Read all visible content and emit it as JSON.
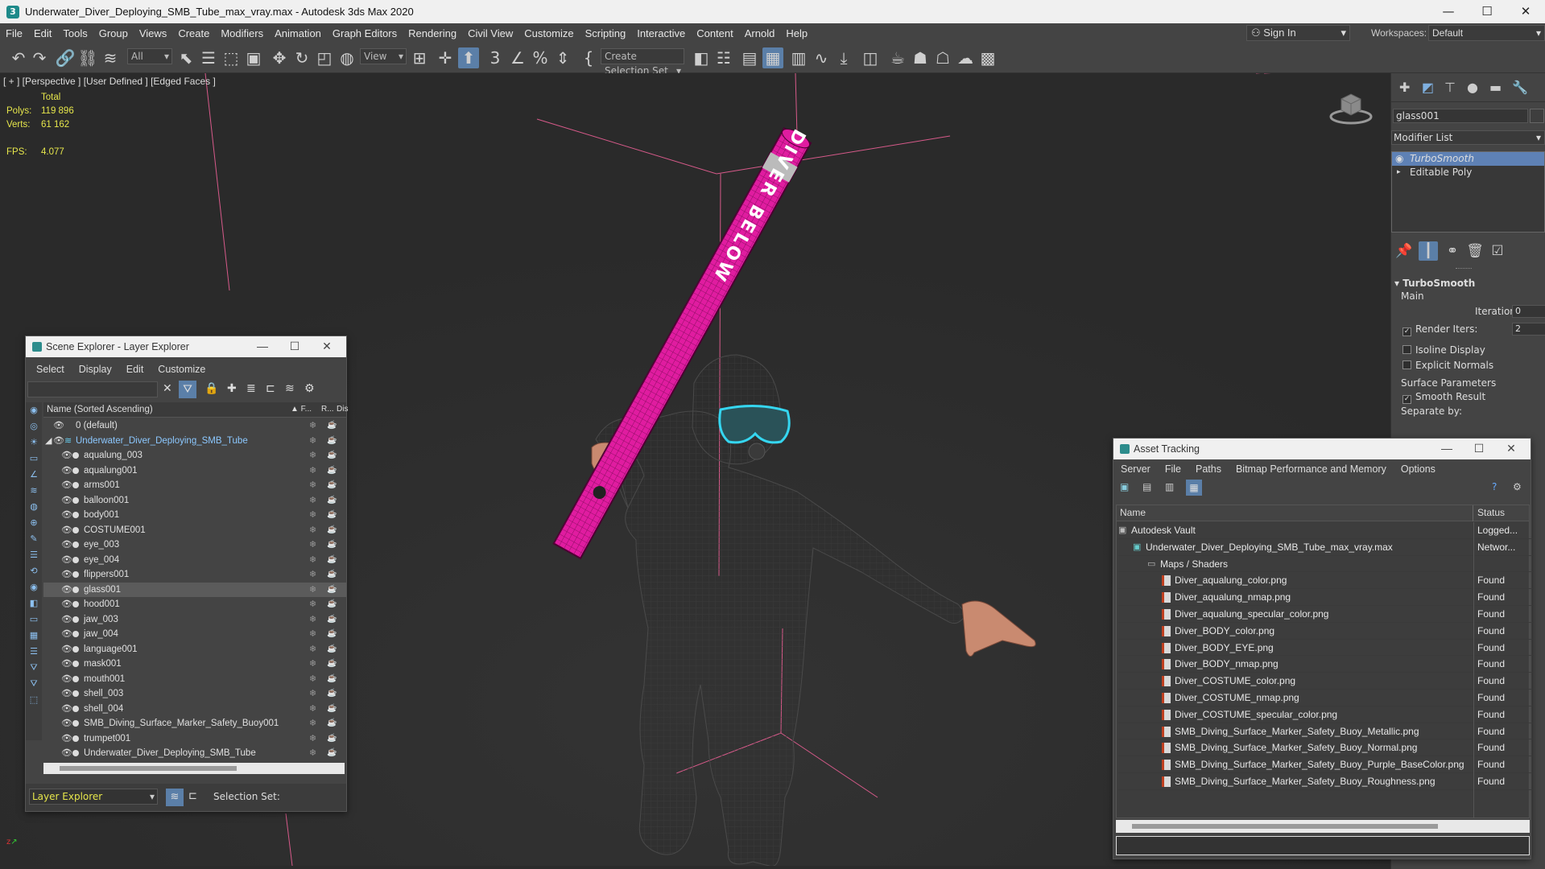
{
  "title_bar": {
    "text": "Underwater_Diver_Deploying_SMB_Tube_max_vray.max - Autodesk 3ds Max 2020",
    "min": "—",
    "max": "☐",
    "close": "✕"
  },
  "menu": [
    "File",
    "Edit",
    "Tools",
    "Group",
    "Views",
    "Create",
    "Modifiers",
    "Animation",
    "Graph Editors",
    "Rendering",
    "Civil View",
    "Customize",
    "Scripting",
    "Interactive",
    "Content",
    "Arnold",
    "Help"
  ],
  "signin": "Sign In",
  "workspaces": {
    "label": "Workspaces:",
    "value": "Default"
  },
  "toolbar": {
    "filter_value": "All",
    "refcoord_value": "View",
    "selection_set": "Create Selection Set"
  },
  "viewport": {
    "label": "[ + ] [Perspective ] [User Defined ] [Edged Faces ]",
    "stats": {
      "total_label": "Total",
      "polys_label": "Polys:",
      "polys": "119 896",
      "verts_label": "Verts:",
      "verts": "61 162",
      "fps_label": "FPS:",
      "fps": "4.077"
    },
    "tube_text": "DIVER BELOW"
  },
  "command_panel": {
    "object_name": "glass001",
    "modifier_list": "Modifier List",
    "stack": [
      "TurboSmooth",
      "Editable Poly"
    ],
    "rollout": {
      "title": "TurboSmooth",
      "main": "Main",
      "iterations_label": "Iterations:",
      "iterations": "0",
      "render_iters_label": "Render Iters:",
      "render_iters": "2",
      "isoline": "Isoline Display",
      "explicit": "Explicit Normals",
      "surface": "Surface Parameters",
      "smooth": "Smooth Result",
      "separate": "Separate by:"
    }
  },
  "scene_explorer": {
    "title": "Scene Explorer - Layer Explorer",
    "menu": [
      "Select",
      "Display",
      "Edit",
      "Customize"
    ],
    "col_name": "Name (Sorted Ascending)",
    "col_f": "▲ F...",
    "col_r": "R...",
    "col_d": "Dis",
    "rows": [
      {
        "name": "0 (default)",
        "lvl": 0,
        "kind": "layer"
      },
      {
        "name": "Underwater_Diver_Deploying_SMB_Tube",
        "lvl": 0,
        "kind": "layer-open"
      },
      {
        "name": "aqualung_003",
        "lvl": 1
      },
      {
        "name": "aqualung001",
        "lvl": 1
      },
      {
        "name": "arms001",
        "lvl": 1
      },
      {
        "name": "balloon001",
        "lvl": 1
      },
      {
        "name": "body001",
        "lvl": 1
      },
      {
        "name": "COSTUME001",
        "lvl": 1
      },
      {
        "name": "eye_003",
        "lvl": 1
      },
      {
        "name": "eye_004",
        "lvl": 1
      },
      {
        "name": "flippers001",
        "lvl": 1
      },
      {
        "name": "glass001",
        "lvl": 1,
        "selected": true
      },
      {
        "name": "hood001",
        "lvl": 1
      },
      {
        "name": "jaw_003",
        "lvl": 1
      },
      {
        "name": "jaw_004",
        "lvl": 1
      },
      {
        "name": "language001",
        "lvl": 1
      },
      {
        "name": "mask001",
        "lvl": 1
      },
      {
        "name": "mouth001",
        "lvl": 1
      },
      {
        "name": "shell_003",
        "lvl": 1
      },
      {
        "name": "shell_004",
        "lvl": 1
      },
      {
        "name": "SMB_Diving_Surface_Marker_Safety_Buoy001",
        "lvl": 1
      },
      {
        "name": "trumpet001",
        "lvl": 1
      },
      {
        "name": "Underwater_Diver_Deploying_SMB_Tube",
        "lvl": 1
      }
    ],
    "footer_mode": "Layer Explorer",
    "footer_selset": "Selection Set:"
  },
  "asset_tracking": {
    "title": "Asset Tracking",
    "menu": [
      "Server",
      "File",
      "Paths",
      "Bitmap Performance and Memory",
      "Options"
    ],
    "col_name": "Name",
    "col_status": "Status",
    "rows": [
      {
        "name": "Autodesk Vault",
        "status": "Logged...",
        "lvl": 0
      },
      {
        "name": "Underwater_Diver_Deploying_SMB_Tube_max_vray.max",
        "status": "Networ...",
        "lvl": 1
      },
      {
        "name": "Maps / Shaders",
        "status": "",
        "lvl": 2
      },
      {
        "name": "Diver_aqualung_color.png",
        "status": "Found",
        "lvl": 3
      },
      {
        "name": "Diver_aqualung_nmap.png",
        "status": "Found",
        "lvl": 3
      },
      {
        "name": "Diver_aqualung_specular_color.png",
        "status": "Found",
        "lvl": 3
      },
      {
        "name": "Diver_BODY_color.png",
        "status": "Found",
        "lvl": 3
      },
      {
        "name": "Diver_BODY_EYE.png",
        "status": "Found",
        "lvl": 3
      },
      {
        "name": "Diver_BODY_nmap.png",
        "status": "Found",
        "lvl": 3
      },
      {
        "name": "Diver_COSTUME_color.png",
        "status": "Found",
        "lvl": 3
      },
      {
        "name": "Diver_COSTUME_nmap.png",
        "status": "Found",
        "lvl": 3
      },
      {
        "name": "Diver_COSTUME_specular_color.png",
        "status": "Found",
        "lvl": 3
      },
      {
        "name": "SMB_Diving_Surface_Marker_Safety_Buoy_Metallic.png",
        "status": "Found",
        "lvl": 3
      },
      {
        "name": "SMB_Diving_Surface_Marker_Safety_Buoy_Normal.png",
        "status": "Found",
        "lvl": 3
      },
      {
        "name": "SMB_Diving_Surface_Marker_Safety_Buoy_Purple_BaseColor.png",
        "status": "Found",
        "lvl": 3
      },
      {
        "name": "SMB_Diving_Surface_Marker_Safety_Buoy_Roughness.png",
        "status": "Found",
        "lvl": 3
      }
    ]
  },
  "colors": {
    "accent": "#5e81b5",
    "stats": "#e6e64b",
    "tube": "#e01ca0",
    "goggles": "#35d6f0"
  }
}
